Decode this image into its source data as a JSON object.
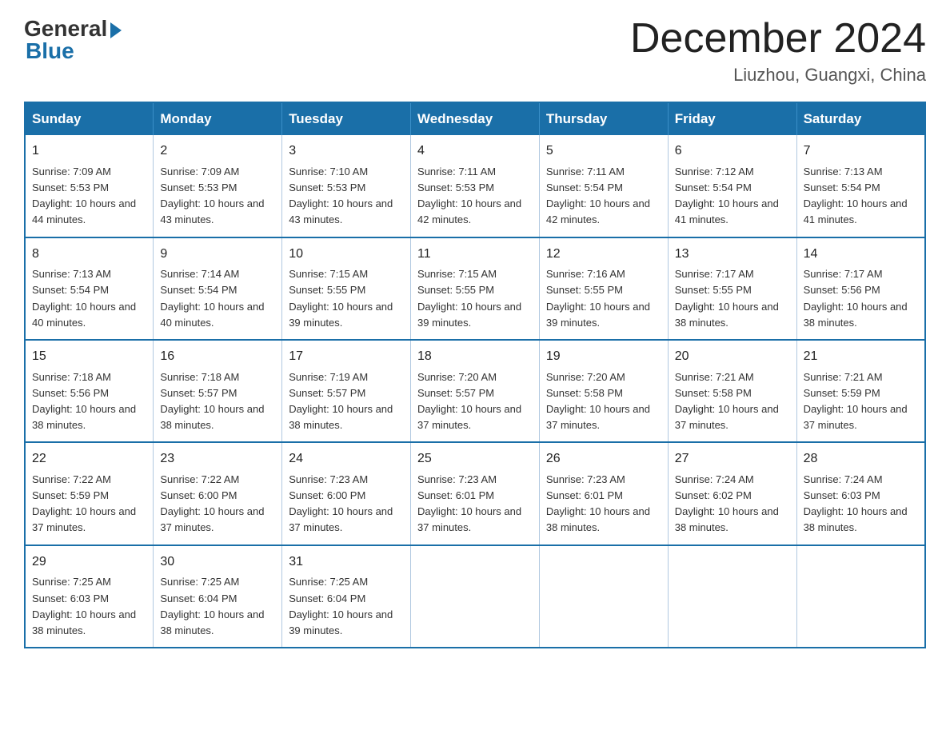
{
  "logo": {
    "general": "General",
    "blue": "Blue"
  },
  "header": {
    "month": "December 2024",
    "location": "Liuzhou, Guangxi, China"
  },
  "weekdays": [
    "Sunday",
    "Monday",
    "Tuesday",
    "Wednesday",
    "Thursday",
    "Friday",
    "Saturday"
  ],
  "weeks": [
    [
      {
        "day": "1",
        "sunrise": "7:09 AM",
        "sunset": "5:53 PM",
        "daylight": "10 hours and 44 minutes."
      },
      {
        "day": "2",
        "sunrise": "7:09 AM",
        "sunset": "5:53 PM",
        "daylight": "10 hours and 43 minutes."
      },
      {
        "day": "3",
        "sunrise": "7:10 AM",
        "sunset": "5:53 PM",
        "daylight": "10 hours and 43 minutes."
      },
      {
        "day": "4",
        "sunrise": "7:11 AM",
        "sunset": "5:53 PM",
        "daylight": "10 hours and 42 minutes."
      },
      {
        "day": "5",
        "sunrise": "7:11 AM",
        "sunset": "5:54 PM",
        "daylight": "10 hours and 42 minutes."
      },
      {
        "day": "6",
        "sunrise": "7:12 AM",
        "sunset": "5:54 PM",
        "daylight": "10 hours and 41 minutes."
      },
      {
        "day": "7",
        "sunrise": "7:13 AM",
        "sunset": "5:54 PM",
        "daylight": "10 hours and 41 minutes."
      }
    ],
    [
      {
        "day": "8",
        "sunrise": "7:13 AM",
        "sunset": "5:54 PM",
        "daylight": "10 hours and 40 minutes."
      },
      {
        "day": "9",
        "sunrise": "7:14 AM",
        "sunset": "5:54 PM",
        "daylight": "10 hours and 40 minutes."
      },
      {
        "day": "10",
        "sunrise": "7:15 AM",
        "sunset": "5:55 PM",
        "daylight": "10 hours and 39 minutes."
      },
      {
        "day": "11",
        "sunrise": "7:15 AM",
        "sunset": "5:55 PM",
        "daylight": "10 hours and 39 minutes."
      },
      {
        "day": "12",
        "sunrise": "7:16 AM",
        "sunset": "5:55 PM",
        "daylight": "10 hours and 39 minutes."
      },
      {
        "day": "13",
        "sunrise": "7:17 AM",
        "sunset": "5:55 PM",
        "daylight": "10 hours and 38 minutes."
      },
      {
        "day": "14",
        "sunrise": "7:17 AM",
        "sunset": "5:56 PM",
        "daylight": "10 hours and 38 minutes."
      }
    ],
    [
      {
        "day": "15",
        "sunrise": "7:18 AM",
        "sunset": "5:56 PM",
        "daylight": "10 hours and 38 minutes."
      },
      {
        "day": "16",
        "sunrise": "7:18 AM",
        "sunset": "5:57 PM",
        "daylight": "10 hours and 38 minutes."
      },
      {
        "day": "17",
        "sunrise": "7:19 AM",
        "sunset": "5:57 PM",
        "daylight": "10 hours and 38 minutes."
      },
      {
        "day": "18",
        "sunrise": "7:20 AM",
        "sunset": "5:57 PM",
        "daylight": "10 hours and 37 minutes."
      },
      {
        "day": "19",
        "sunrise": "7:20 AM",
        "sunset": "5:58 PM",
        "daylight": "10 hours and 37 minutes."
      },
      {
        "day": "20",
        "sunrise": "7:21 AM",
        "sunset": "5:58 PM",
        "daylight": "10 hours and 37 minutes."
      },
      {
        "day": "21",
        "sunrise": "7:21 AM",
        "sunset": "5:59 PM",
        "daylight": "10 hours and 37 minutes."
      }
    ],
    [
      {
        "day": "22",
        "sunrise": "7:22 AM",
        "sunset": "5:59 PM",
        "daylight": "10 hours and 37 minutes."
      },
      {
        "day": "23",
        "sunrise": "7:22 AM",
        "sunset": "6:00 PM",
        "daylight": "10 hours and 37 minutes."
      },
      {
        "day": "24",
        "sunrise": "7:23 AM",
        "sunset": "6:00 PM",
        "daylight": "10 hours and 37 minutes."
      },
      {
        "day": "25",
        "sunrise": "7:23 AM",
        "sunset": "6:01 PM",
        "daylight": "10 hours and 37 minutes."
      },
      {
        "day": "26",
        "sunrise": "7:23 AM",
        "sunset": "6:01 PM",
        "daylight": "10 hours and 38 minutes."
      },
      {
        "day": "27",
        "sunrise": "7:24 AM",
        "sunset": "6:02 PM",
        "daylight": "10 hours and 38 minutes."
      },
      {
        "day": "28",
        "sunrise": "7:24 AM",
        "sunset": "6:03 PM",
        "daylight": "10 hours and 38 minutes."
      }
    ],
    [
      {
        "day": "29",
        "sunrise": "7:25 AM",
        "sunset": "6:03 PM",
        "daylight": "10 hours and 38 minutes."
      },
      {
        "day": "30",
        "sunrise": "7:25 AM",
        "sunset": "6:04 PM",
        "daylight": "10 hours and 38 minutes."
      },
      {
        "day": "31",
        "sunrise": "7:25 AM",
        "sunset": "6:04 PM",
        "daylight": "10 hours and 39 minutes."
      },
      null,
      null,
      null,
      null
    ]
  ],
  "labels": {
    "sunrise": "Sunrise:",
    "sunset": "Sunset:",
    "daylight": "Daylight:"
  }
}
